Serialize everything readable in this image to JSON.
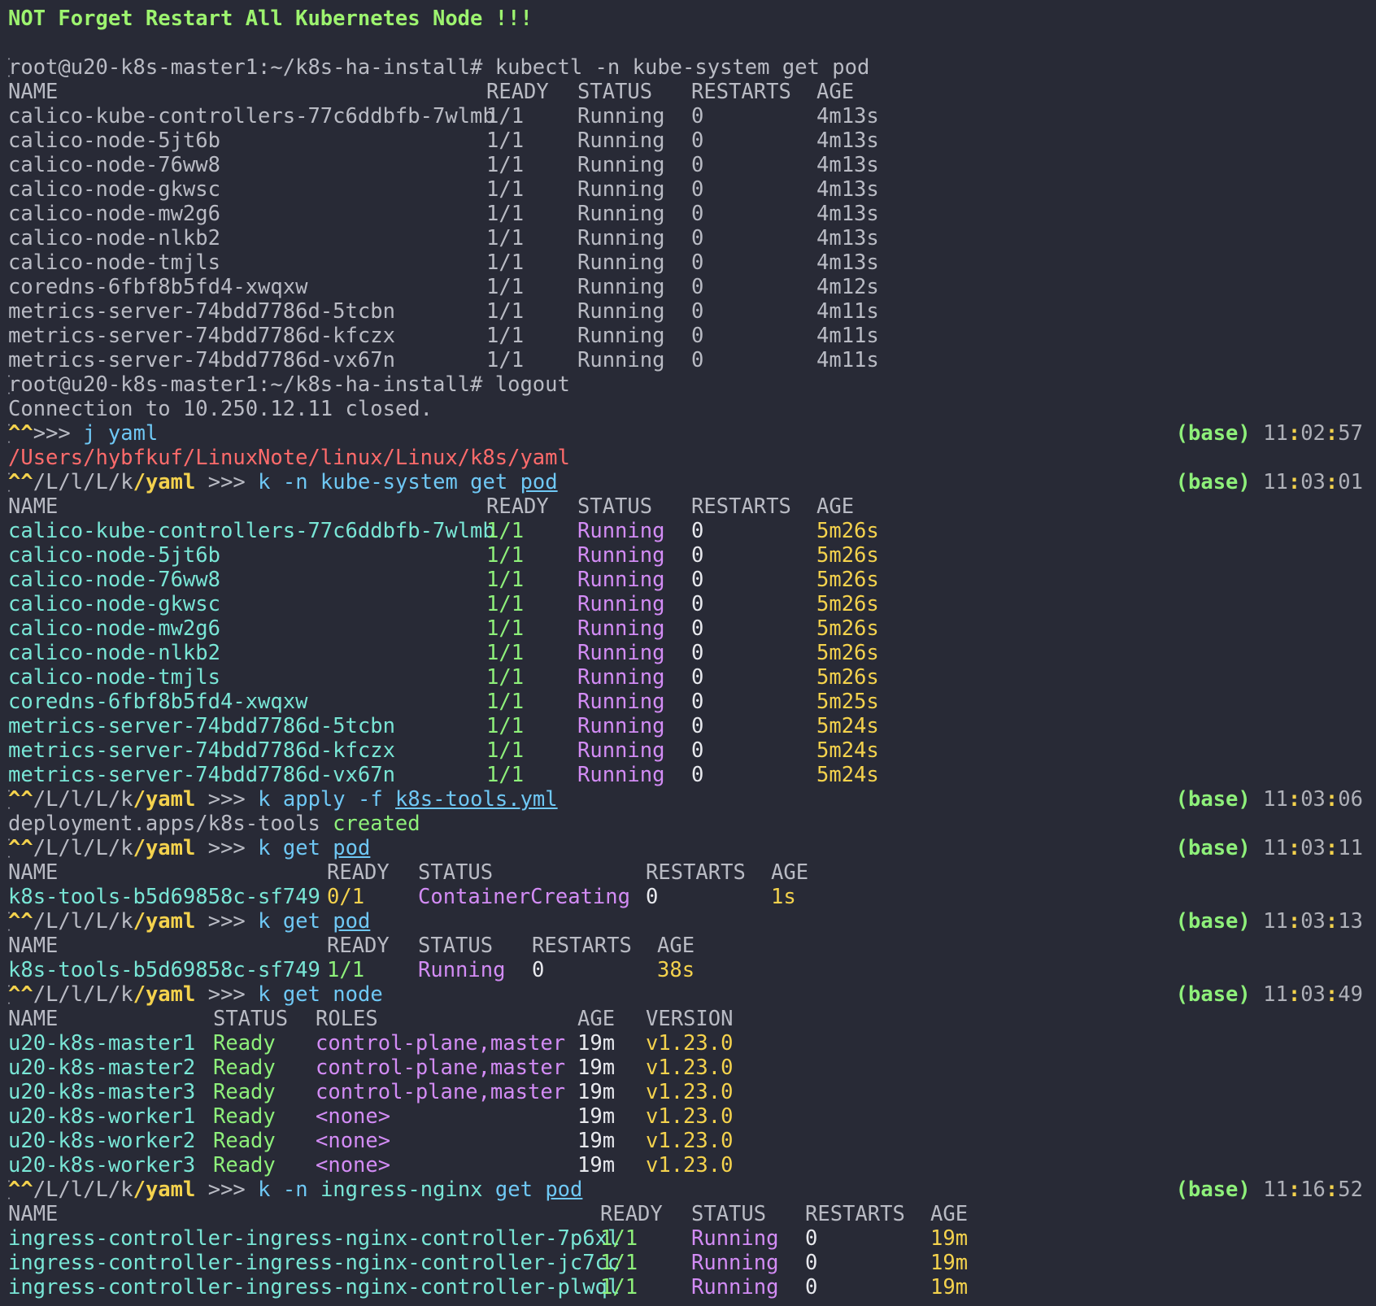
{
  "banner": "NOT Forget Restart All Kubernetes Node !!!",
  "session1": {
    "cmd_line": "root@u20-k8s-master1:~/k8s-ha-install# kubectl -n kube-system get pod",
    "headers": [
      "NAME",
      "READY",
      "STATUS",
      "RESTARTS",
      "AGE"
    ],
    "rows": [
      [
        "calico-kube-controllers-77c6ddbfb-7wlmb",
        "1/1",
        "Running",
        "0",
        "4m13s"
      ],
      [
        "calico-node-5jt6b",
        "1/1",
        "Running",
        "0",
        "4m13s"
      ],
      [
        "calico-node-76ww8",
        "1/1",
        "Running",
        "0",
        "4m13s"
      ],
      [
        "calico-node-gkwsc",
        "1/1",
        "Running",
        "0",
        "4m13s"
      ],
      [
        "calico-node-mw2g6",
        "1/1",
        "Running",
        "0",
        "4m13s"
      ],
      [
        "calico-node-nlkb2",
        "1/1",
        "Running",
        "0",
        "4m13s"
      ],
      [
        "calico-node-tmjls",
        "1/1",
        "Running",
        "0",
        "4m13s"
      ],
      [
        "coredns-6fbf8b5fd4-xwqxw",
        "1/1",
        "Running",
        "0",
        "4m12s"
      ],
      [
        "metrics-server-74bdd7786d-5tcbn",
        "1/1",
        "Running",
        "0",
        "4m11s"
      ],
      [
        "metrics-server-74bdd7786d-kfczx",
        "1/1",
        "Running",
        "0",
        "4m11s"
      ],
      [
        "metrics-server-74bdd7786d-vx67n",
        "1/1",
        "Running",
        "0",
        "4m11s"
      ]
    ],
    "logout_line": "root@u20-k8s-master1:~/k8s-ha-install# logout",
    "closed_line": "Connection to 10.250.12.11 closed."
  },
  "prompt": {
    "caret": "^^",
    "arrows": ">>>",
    "path_seg1": "/L",
    "path_seg2": "/l",
    "path_seg3": "/L",
    "path_seg4": "/k",
    "path_seg5": "/yaml",
    "env": "(base)"
  },
  "jump": {
    "cmd_j": "j",
    "cmd_arg": "yaml",
    "clock": {
      "h": "11",
      "m": "02",
      "s": "57"
    },
    "path_output": "/Users/hybfkuf/LinuxNote/linux/Linux/k8s/yaml"
  },
  "cmd_get_pod_ns": {
    "k": "k",
    "rest": "-n kube-system get",
    "pod": "pod",
    "clock": {
      "h": "11",
      "m": "03",
      "s": "01"
    },
    "headers": [
      "NAME",
      "READY",
      "STATUS",
      "RESTARTS",
      "AGE"
    ],
    "rows": [
      [
        "calico-kube-controllers-77c6ddbfb-7wlmb",
        "1/1",
        "Running",
        "0",
        "5m26s"
      ],
      [
        "calico-node-5jt6b",
        "1/1",
        "Running",
        "0",
        "5m26s"
      ],
      [
        "calico-node-76ww8",
        "1/1",
        "Running",
        "0",
        "5m26s"
      ],
      [
        "calico-node-gkwsc",
        "1/1",
        "Running",
        "0",
        "5m26s"
      ],
      [
        "calico-node-mw2g6",
        "1/1",
        "Running",
        "0",
        "5m26s"
      ],
      [
        "calico-node-nlkb2",
        "1/1",
        "Running",
        "0",
        "5m26s"
      ],
      [
        "calico-node-tmjls",
        "1/1",
        "Running",
        "0",
        "5m26s"
      ],
      [
        "coredns-6fbf8b5fd4-xwqxw",
        "1/1",
        "Running",
        "0",
        "5m25s"
      ],
      [
        "metrics-server-74bdd7786d-5tcbn",
        "1/1",
        "Running",
        "0",
        "5m24s"
      ],
      [
        "metrics-server-74bdd7786d-kfczx",
        "1/1",
        "Running",
        "0",
        "5m24s"
      ],
      [
        "metrics-server-74bdd7786d-vx67n",
        "1/1",
        "Running",
        "0",
        "5m24s"
      ]
    ]
  },
  "cmd_apply": {
    "k": "k",
    "rest": "apply -f",
    "file": "k8s-tools.yml",
    "clock": {
      "h": "11",
      "m": "03",
      "s": "06"
    },
    "output_prefix": "deployment.apps/k8s-tools",
    "output_status": "created"
  },
  "cmd_get_pod1": {
    "k": "k",
    "rest": "get",
    "pod": "pod",
    "clock": {
      "h": "11",
      "m": "03",
      "s": "11"
    },
    "headers": [
      "NAME",
      "READY",
      "STATUS",
      "RESTARTS",
      "AGE"
    ],
    "row": [
      "k8s-tools-b5d69858c-sf749",
      "0/1",
      "ContainerCreating",
      "0",
      "1s"
    ]
  },
  "cmd_get_pod2": {
    "k": "k",
    "rest": "get",
    "pod": "pod",
    "clock": {
      "h": "11",
      "m": "03",
      "s": "13"
    },
    "headers": [
      "NAME",
      "READY",
      "STATUS",
      "RESTARTS",
      "AGE"
    ],
    "row": [
      "k8s-tools-b5d69858c-sf749",
      "1/1",
      "Running",
      "0",
      "38s"
    ]
  },
  "cmd_get_node": {
    "k": "k",
    "rest": "get node",
    "clock": {
      "h": "11",
      "m": "03",
      "s": "49"
    },
    "headers": [
      "NAME",
      "STATUS",
      "ROLES",
      "AGE",
      "VERSION"
    ],
    "rows": [
      [
        "u20-k8s-master1",
        "Ready",
        "control-plane,master",
        "19m",
        "v1.23.0"
      ],
      [
        "u20-k8s-master2",
        "Ready",
        "control-plane,master",
        "19m",
        "v1.23.0"
      ],
      [
        "u20-k8s-master3",
        "Ready",
        "control-plane,master",
        "19m",
        "v1.23.0"
      ],
      [
        "u20-k8s-worker1",
        "Ready",
        "<none>",
        "19m",
        "v1.23.0"
      ],
      [
        "u20-k8s-worker2",
        "Ready",
        "<none>",
        "19m",
        "v1.23.0"
      ],
      [
        "u20-k8s-worker3",
        "Ready",
        "<none>",
        "19m",
        "v1.23.0"
      ]
    ]
  },
  "cmd_ingress": {
    "k": "k",
    "flag": "-n",
    "ns": "ingress-nginx",
    "get": "get",
    "pod": "pod",
    "clock": {
      "h": "11",
      "m": "16",
      "s": "52"
    },
    "headers": [
      "NAME",
      "READY",
      "STATUS",
      "RESTARTS",
      "AGE"
    ],
    "rows": [
      [
        "ingress-controller-ingress-nginx-controller-7p6xl",
        "1/1",
        "Running",
        "0",
        "19m"
      ],
      [
        "ingress-controller-ingress-nginx-controller-jc7cc",
        "1/1",
        "Running",
        "0",
        "19m"
      ],
      [
        "ingress-controller-ingress-nginx-controller-plwql",
        "1/1",
        "Running",
        "0",
        "19m"
      ]
    ]
  },
  "colors": {
    "background": "#282a36",
    "foreground": "#d6d8df",
    "name_cyan": "#79e6d6",
    "ready_green": "#8ef07a",
    "status_purple": "#d38cf5",
    "age_yellow": "#f4d24d",
    "command_blue": "#6fc8f5",
    "path_red": "#ff6b6b"
  }
}
